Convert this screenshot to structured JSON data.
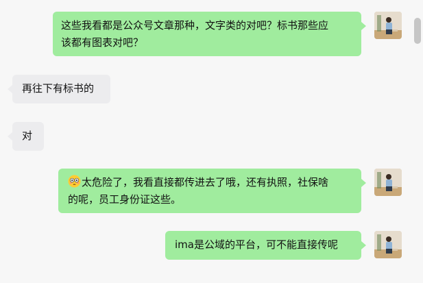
{
  "messages": [
    {
      "side": "right",
      "text_line1": "这些我看都是公众号文章那种，文字类的对吧？标书那些应",
      "text_line2": "该都有图表对吧？"
    },
    {
      "side": "left",
      "text": "再往下有标书的"
    },
    {
      "side": "left",
      "text": "对"
    },
    {
      "side": "right",
      "emoji_icon": "flushed-face-icon",
      "text_line1": "太危险了，我看直接都传进去了哦，还有执照，社保啥",
      "text_line2": "的呢，员工身份证这些。"
    },
    {
      "side": "right",
      "text": "ima是公域的平台，可不能直接传呢"
    }
  ],
  "colors": {
    "my_bubble": "#a0ec9e",
    "their_bubble": "#ececee",
    "background": "#f7f7f7"
  }
}
